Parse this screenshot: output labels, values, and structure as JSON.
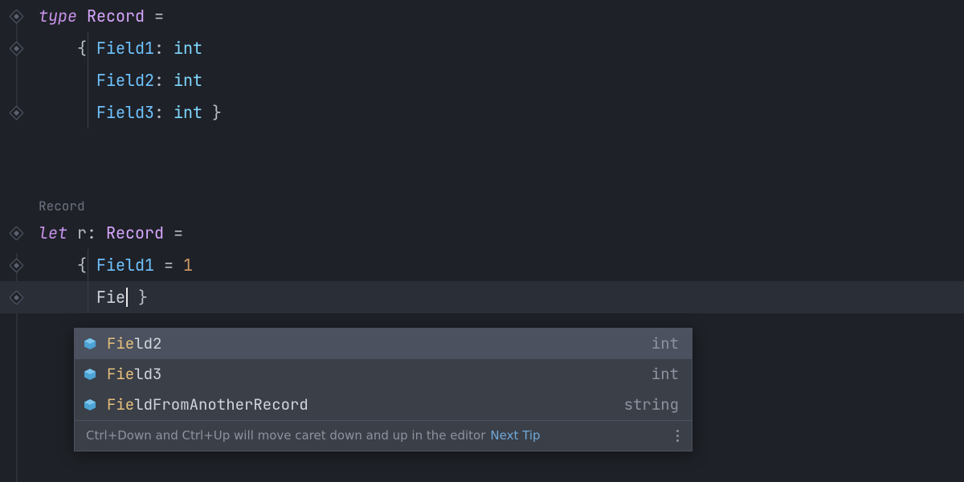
{
  "inlay": {
    "typeName": "Record"
  },
  "code": {
    "line1": {
      "kw": "type",
      "name": "Record",
      "eq": " ="
    },
    "line2": {
      "brace": "{ ",
      "field": "Field1",
      "colon": ":",
      "type": "int"
    },
    "line3": {
      "field": "Field2",
      "colon": ":",
      "type": "int"
    },
    "line4": {
      "field": "Field3",
      "colon": ":",
      "type": "int",
      "close": " }"
    },
    "line7": {
      "kw": "let",
      "name": "r",
      "colon": ":",
      "type": "Record",
      "eq": " ="
    },
    "line8": {
      "brace": "{ ",
      "field": "Field1",
      "eq": " = ",
      "val": "1"
    },
    "line9": {
      "typed": "Fie",
      "close": " }"
    }
  },
  "completion": {
    "items": [
      {
        "match": "Fie",
        "rest": "ld2",
        "type": "int",
        "selected": true
      },
      {
        "match": "Fie",
        "rest": "ld3",
        "type": "int",
        "selected": false
      },
      {
        "match": "Fie",
        "rest": "ldFromAnotherRecord",
        "type": "string",
        "selected": false
      }
    ],
    "hint": "Ctrl+Down and Ctrl+Up will move caret down and up in the editor",
    "nextTip": "Next Tip"
  }
}
